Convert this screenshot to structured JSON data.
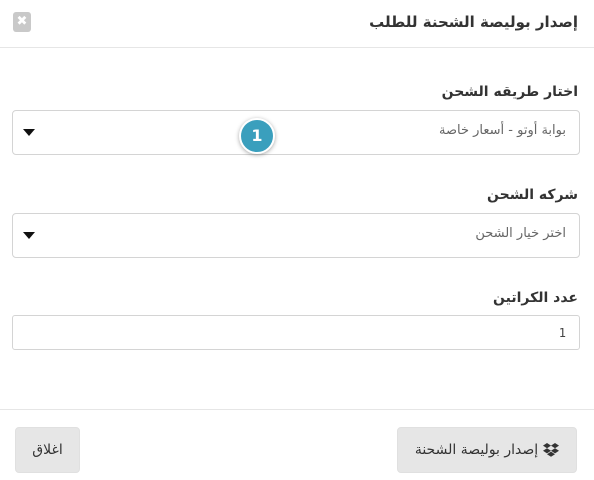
{
  "modal": {
    "title": "إصدار بوليصة الشحنة للطلب",
    "close_icon": "close-icon",
    "close_glyph": "✖"
  },
  "shipping_method": {
    "label": "اختار طريقه الشحن",
    "selected": "بوابة أوتو - أسعار خاصة"
  },
  "shipping_company": {
    "label": "شركه الشحن",
    "selected": "اختر خيار الشحن"
  },
  "cartons": {
    "label": "عدد الكراتين",
    "value": "1"
  },
  "step_badge": {
    "number": "1",
    "color": "#3a9fbd"
  },
  "footer": {
    "issue_label": "إصدار بوليصة الشحنة",
    "issue_icon": "dropbox-icon",
    "close_label": "اغلاق"
  }
}
